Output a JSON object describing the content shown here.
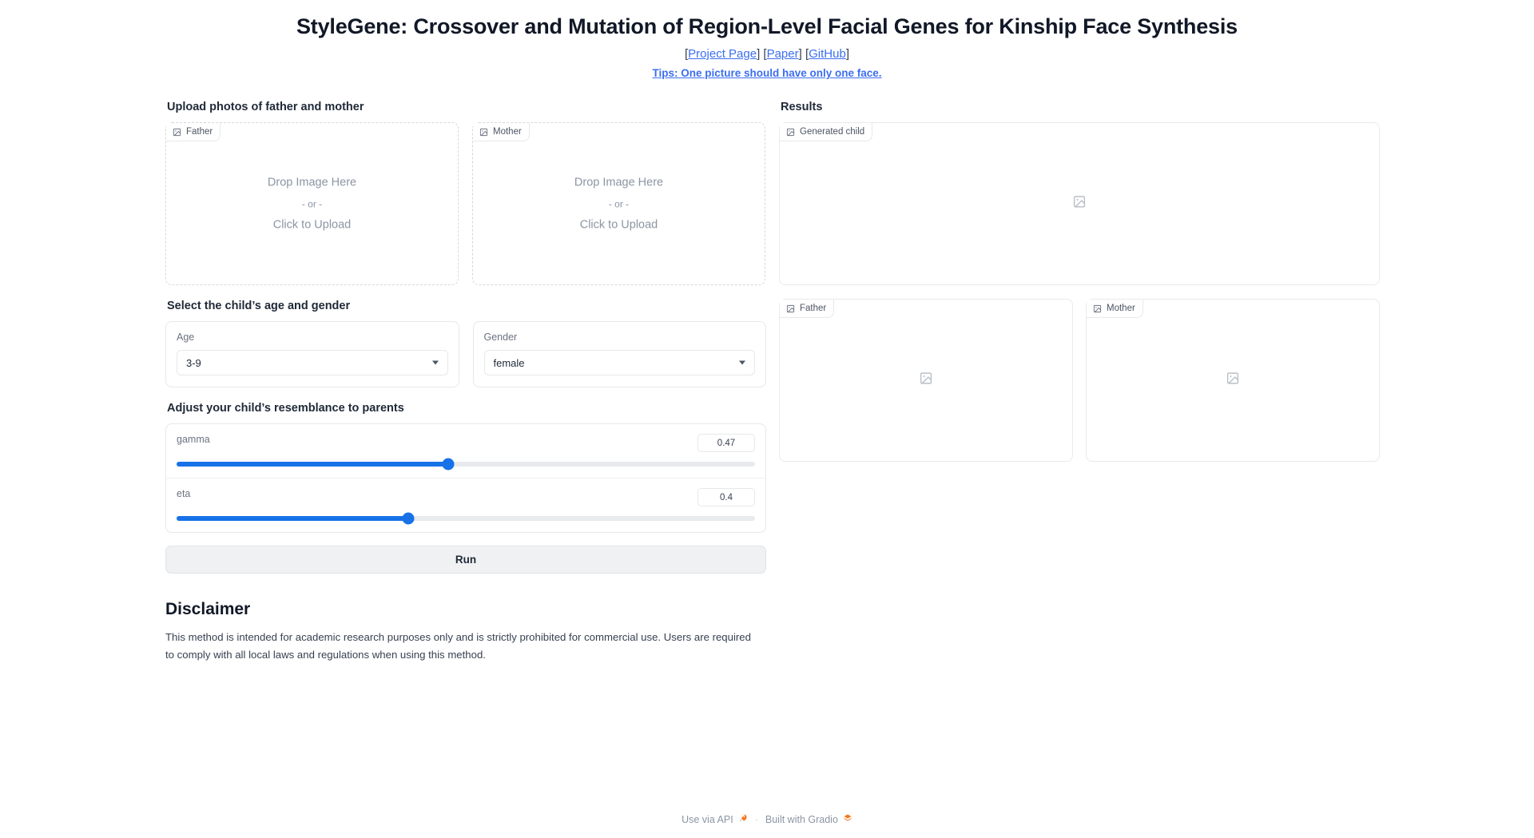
{
  "header": {
    "title": "StyleGene: Crossover and Mutation of Region-Level Facial Genes for Kinship Face Synthesis",
    "bracket_open": "[",
    "bracket_close": "]",
    "links": [
      {
        "label": "Project Page"
      },
      {
        "label": "Paper"
      },
      {
        "label": "GitHub"
      }
    ],
    "tips": "Tips: One picture should have only one face."
  },
  "left": {
    "upload_section_label": "Upload photos of father and mother",
    "upload_boxes": [
      {
        "tab_label": "Father",
        "tab_icon": "image-icon",
        "drop_line1": "Drop Image Here",
        "drop_line2": "- or -",
        "drop_line3": "Click to Upload"
      },
      {
        "tab_label": "Mother",
        "tab_icon": "image-icon",
        "drop_line1": "Drop Image Here",
        "drop_line2": "- or -",
        "drop_line3": "Click to Upload"
      }
    ],
    "age_gender_label": "Select the child’s age and gender",
    "age": {
      "label": "Age",
      "value": "3-9",
      "icon": "chevron-down-icon"
    },
    "gender": {
      "label": "Gender",
      "value": "female",
      "icon": "chevron-down-icon"
    },
    "resemblance_label": "Adjust your child’s resemblance to parents",
    "sliders": [
      {
        "name": "gamma",
        "value": "0.47",
        "percent": 47
      },
      {
        "name": "eta",
        "value": "0.4",
        "percent": 40
      }
    ],
    "run_label": "Run",
    "disclaimer": {
      "title": "Disclaimer",
      "body": "This method is intended for academic research purposes only and is strictly prohibited for commercial use. Users are required to comply with all local laws and regulations when using this method."
    }
  },
  "right": {
    "results_label": "Results",
    "generated": {
      "tab_label": "Generated child",
      "tab_icon": "image-icon",
      "placeholder_icon": "image-placeholder-icon"
    },
    "parents": [
      {
        "tab_label": "Father",
        "tab_icon": "image-icon",
        "placeholder_icon": "image-placeholder-icon"
      },
      {
        "tab_label": "Mother",
        "tab_icon": "image-icon",
        "placeholder_icon": "image-placeholder-icon"
      }
    ]
  },
  "footer": {
    "api_label": "Use via API",
    "api_icon": "rocket-icon",
    "separator": "·",
    "gradio_label": "Built with Gradio",
    "gradio_icon": "gradio-logo-icon"
  },
  "colors": {
    "accent_blue": "#1772e8",
    "link_blue": "#3b6ef0",
    "text_dark": "#1f2937",
    "muted": "#8b95a3"
  }
}
